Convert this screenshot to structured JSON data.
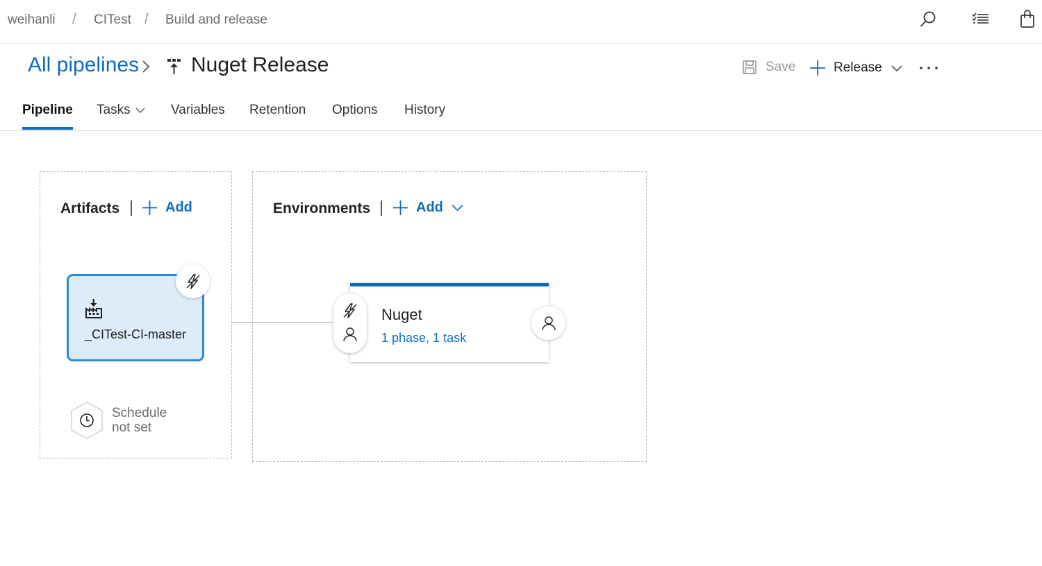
{
  "breadcrumb": {
    "items": [
      "weihanli",
      "CITest",
      "Build and release"
    ],
    "separator": "/"
  },
  "header": {
    "back_link": "All pipelines",
    "title": "Nuget Release",
    "save_label": "Save",
    "release_label": "Release"
  },
  "tabs": [
    "Pipeline",
    "Tasks",
    "Variables",
    "Retention",
    "Options",
    "History"
  ],
  "artifacts": {
    "title": "Artifacts",
    "add_label": "Add",
    "artifact_name": "_CITest-CI-master",
    "schedule_line1": "Schedule",
    "schedule_line2": "not set"
  },
  "environments": {
    "title": "Environments",
    "add_label": "Add",
    "env_name": "Nuget",
    "env_summary": "1 phase, 1 task"
  },
  "colors": {
    "accent": "#0f6cbd",
    "artifact_fill": "#deecf9",
    "artifact_border": "#2b88d8"
  },
  "icons": [
    "search-icon",
    "notifications-list-icon",
    "shopping-bag-icon",
    "save-icon",
    "plus-icon",
    "chevron-down-icon",
    "more-icon",
    "release-pipeline-icon",
    "lightning-icon",
    "build-artifact-icon",
    "clock-icon",
    "person-icon"
  ]
}
